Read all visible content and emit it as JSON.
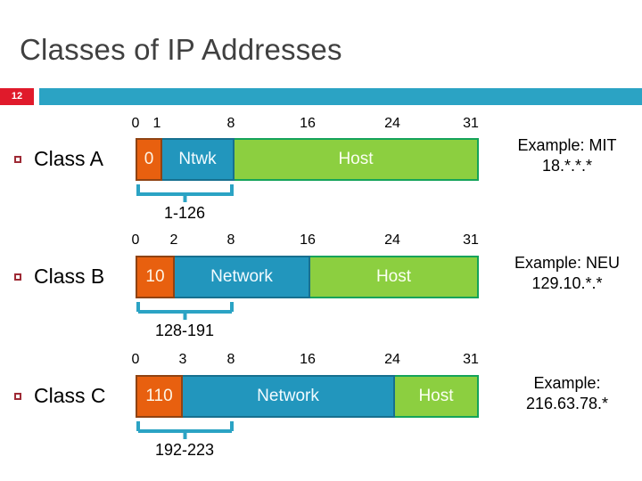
{
  "slide": {
    "title": "Classes of IP Addresses",
    "number": "12",
    "colors": {
      "title_gray": "#404040",
      "band_teal": "#2ba3c4",
      "badge_red": "#e01a2b",
      "prefix_orange": "#e8600f",
      "network_teal": "#2296bd",
      "host_green": "#8ccf40",
      "bullet_maroon": "#9e2a35"
    }
  },
  "rows": [
    {
      "label": "Class A",
      "ticks": [
        "0",
        "1",
        "8",
        "16",
        "24",
        "31"
      ],
      "segments": [
        {
          "name": "prefix",
          "text": "0"
        },
        {
          "name": "network",
          "text": "Ntwk"
        },
        {
          "name": "host",
          "text": "Host"
        }
      ],
      "range": "1-126",
      "example_line1": "Example: MIT",
      "example_line2": "18.*.*.*"
    },
    {
      "label": "Class B",
      "ticks": [
        "0",
        "2",
        "8",
        "16",
        "24",
        "31"
      ],
      "segments": [
        {
          "name": "prefix",
          "text": "10"
        },
        {
          "name": "network",
          "text": "Network"
        },
        {
          "name": "host",
          "text": "Host"
        }
      ],
      "range": "128-191",
      "example_line1": "Example: NEU",
      "example_line2": "129.10.*.*"
    },
    {
      "label": "Class C",
      "ticks": [
        "0",
        "3",
        "8",
        "16",
        "24",
        "31"
      ],
      "segments": [
        {
          "name": "prefix",
          "text": "110"
        },
        {
          "name": "network",
          "text": "Network"
        },
        {
          "name": "host",
          "text": "Host"
        }
      ],
      "range": "192-223",
      "example_line1": "Example:",
      "example_line2": "216.63.78.*"
    }
  ]
}
